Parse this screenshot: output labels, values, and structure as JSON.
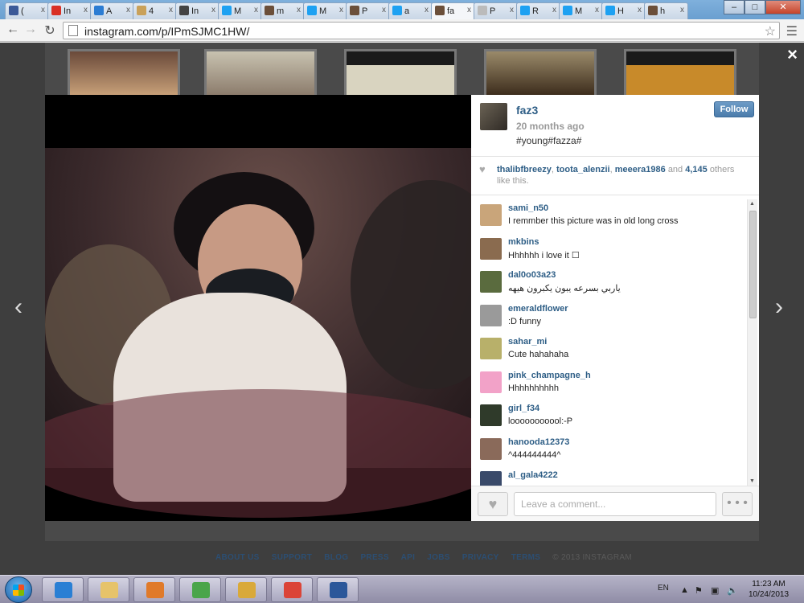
{
  "tabs": [
    {
      "label": "(",
      "color": "#3b5998"
    },
    {
      "label": "In",
      "color": "#d93025"
    },
    {
      "label": "A",
      "color": "#2b7cd3"
    },
    {
      "label": "4",
      "color": "#c9a15a"
    },
    {
      "label": "In",
      "color": "#444444"
    },
    {
      "label": "M",
      "color": "#1da1f2"
    },
    {
      "label": "m",
      "color": "#6b4f3a"
    },
    {
      "label": "M",
      "color": "#1da1f2"
    },
    {
      "label": "P",
      "color": "#6b4f3a"
    },
    {
      "label": "a",
      "color": "#1da1f2"
    },
    {
      "label": "fa",
      "color": "#6b4f3a"
    },
    {
      "label": "P",
      "color": "#bbbbbb"
    },
    {
      "label": "R",
      "color": "#1da1f2"
    },
    {
      "label": "M",
      "color": "#1da1f2"
    },
    {
      "label": "H",
      "color": "#1da1f2"
    },
    {
      "label": "h",
      "color": "#6b4f3a"
    }
  ],
  "tab_close": "x",
  "address_bar": {
    "url": "instagram.com/p/IPmSJMC1HW/"
  },
  "window_controls": {
    "minimize": "–",
    "maximize": "□",
    "close": "✕"
  },
  "overlay": {
    "close": "×",
    "prev": "‹",
    "next": "›"
  },
  "post": {
    "username": "faz3",
    "time_ago": "20 months ago",
    "caption": "#young#fazza#",
    "follow_label": "Follow",
    "likes": {
      "users": [
        "thalibfbreezy",
        "toota_alenzii",
        "meeera1986"
      ],
      "and_text": "and",
      "count": "4,145",
      "suffix": "others like this."
    }
  },
  "comments": [
    {
      "user": "sami_n50",
      "text": "I remmber this picture was in old long cross",
      "color": "#c9a57a"
    },
    {
      "user": "mkbins",
      "text": "Hhhhhh i love it ☐",
      "color": "#8a6b4f"
    },
    {
      "user": "dal0o03a23",
      "text": "ياربي بسرعه يبون يكبرون هيهه",
      "color": "#5a6b3e"
    },
    {
      "user": "emeraldflower",
      "text": ":D funny",
      "color": "#9a9a9a"
    },
    {
      "user": "sahar_mi",
      "text": "Cute hahahaha",
      "color": "#b8b06a"
    },
    {
      "user": "pink_champagne_h",
      "text": "Hhhhhhhhhh",
      "color": "#f2a2c8"
    },
    {
      "user": "girl_f34",
      "text": "looooooooool:-P",
      "color": "#2f3a2a"
    },
    {
      "user": "hanooda12373",
      "text": "^444444444^",
      "color": "#8a6a5a"
    },
    {
      "user": "al_gala4222",
      "text": "",
      "color": "#3a4a6a"
    }
  ],
  "comment_input": {
    "placeholder": "Leave a comment..."
  },
  "more_label": "• • •",
  "footer": {
    "links": [
      "ABOUT US",
      "SUPPORT",
      "BLOG",
      "PRESS",
      "API",
      "JOBS",
      "PRIVACY",
      "TERMS"
    ],
    "copyright": "© 2013 INSTAGRAM"
  },
  "taskbar": {
    "apps": [
      {
        "name": "internet-explorer",
        "color": "#2a7fd4"
      },
      {
        "name": "file-explorer",
        "color": "#e6c36a"
      },
      {
        "name": "media-player",
        "color": "#e07a2a"
      },
      {
        "name": "network-app",
        "color": "#4aa54a"
      },
      {
        "name": "outlook",
        "color": "#d9a93a"
      },
      {
        "name": "chrome",
        "color": "#db4437"
      },
      {
        "name": "word",
        "color": "#2b579a"
      }
    ],
    "language": "EN",
    "time": "11:23 AM",
    "date": "10/24/2013"
  }
}
